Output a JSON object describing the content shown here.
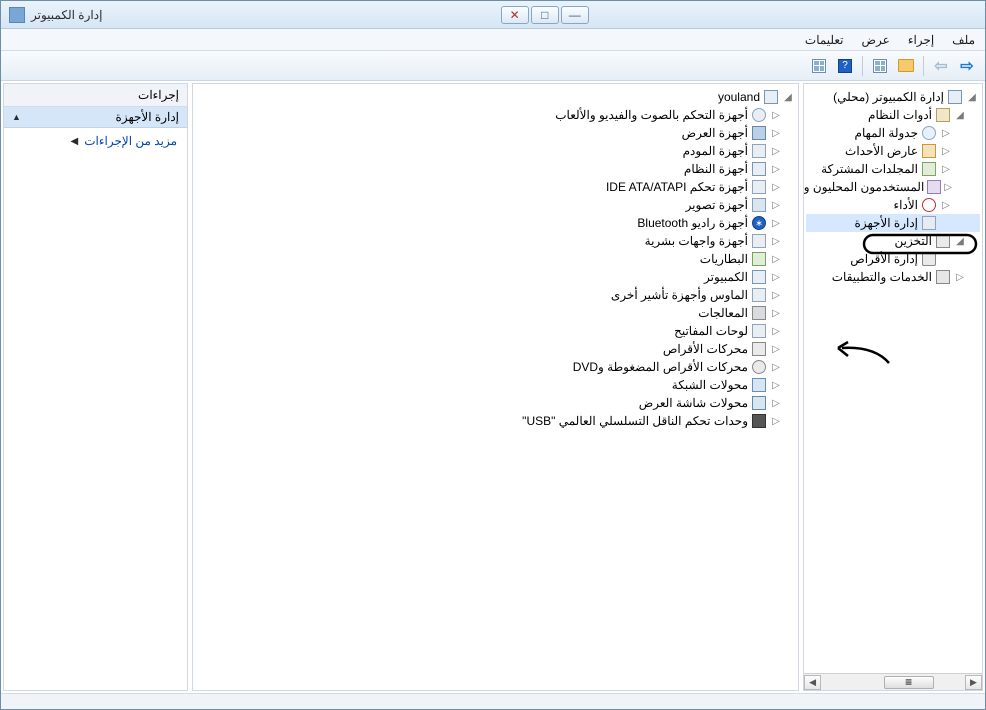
{
  "window": {
    "title": "إدارة الكمبيوتر"
  },
  "menu": {
    "file": "ملف",
    "action": "إجراء",
    "view": "عرض",
    "help": "تعليمات"
  },
  "nav": {
    "root": "إدارة الكمبيوتر (محلي)",
    "sys_tools": "أدوات النظام",
    "task_sched": "جدولة المهام",
    "event_viewer": "عارض الأحداث",
    "shared_folders": "المجلدات المشتركة",
    "local_users": "المستخدمون المحليون والـ",
    "performance": "الأداء",
    "device_mgr": "إدارة الأجهزة",
    "storage": "التخزين",
    "disk_mgmt": "إدارة الأقراص",
    "services_apps": "الخدمات والتطبيقات"
  },
  "devices": {
    "root": "youland",
    "items": [
      {
        "k": "av",
        "label": "أجهزة التحكم بالصوت والفيديو والألعاب"
      },
      {
        "k": "display",
        "label": "أجهزة العرض"
      },
      {
        "k": "modem",
        "label": "أجهزة المودم"
      },
      {
        "k": "system",
        "label": "أجهزة النظام"
      },
      {
        "k": "ide",
        "label": "أجهزة تحكم IDE ATA/ATAPI"
      },
      {
        "k": "imaging",
        "label": "أجهزة تصوير"
      },
      {
        "k": "bt",
        "label": "أجهزة راديو Bluetooth"
      },
      {
        "k": "hid",
        "label": "أجهزة واجهات بشرية"
      },
      {
        "k": "bat",
        "label": "البطاريات"
      },
      {
        "k": "pc",
        "label": "الكمبيوتر"
      },
      {
        "k": "mouse",
        "label": "الماوس وأجهزة تأشير أخرى"
      },
      {
        "k": "cpu",
        "label": "المعالجات"
      },
      {
        "k": "kbd",
        "label": "لوحات المفاتيح"
      },
      {
        "k": "hdd",
        "label": "محركات الأقراص"
      },
      {
        "k": "dvd",
        "label": "محركات الأقراص المضغوطة وDVD"
      },
      {
        "k": "net",
        "label": "محولات الشبكة"
      },
      {
        "k": "gpu",
        "label": "محولات شاشة العرض"
      },
      {
        "k": "usb",
        "label": "وحدات تحكم الناقل التسلسلي العالمي \"USB\""
      }
    ]
  },
  "actions": {
    "header": "إجراءات",
    "group": "إدارة الأجهزة",
    "more": "مزيد من الإجراءات"
  }
}
